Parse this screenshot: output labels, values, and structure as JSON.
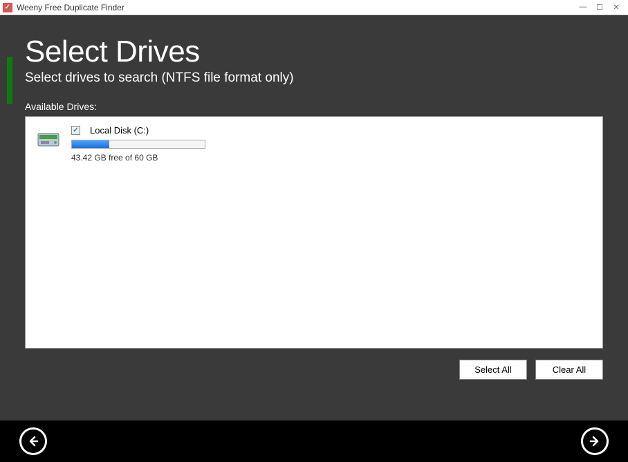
{
  "titlebar": {
    "title": "Weeny Free Duplicate Finder"
  },
  "header": {
    "title": "Select Drives",
    "subtitle": "Select drives to search (NTFS file format only)"
  },
  "section": {
    "available_label": "Available Drives:"
  },
  "drives": [
    {
      "name": "Local Disk (C:)",
      "checked": true,
      "usage_pct": 28,
      "space_text": "43.42 GB free of 60 GB"
    }
  ],
  "buttons": {
    "select_all": "Select All",
    "clear_all": "Clear All"
  }
}
